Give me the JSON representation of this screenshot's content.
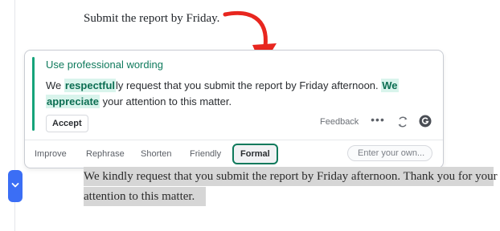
{
  "document": {
    "top_line": "Submit the report by Friday.",
    "selected_line_1": "We kindly request that you submit the report by Friday afternoon. Thank you for your",
    "selected_line_2": "attention to this matter."
  },
  "suggestion_card": {
    "title": "Use professional wording",
    "body": {
      "p1": "We ",
      "h1": "respectful",
      "p2": "ly request that you submit the report by Friday afternoon. ",
      "h2a": "We",
      "h2b": "appreciate",
      "p3": " your attention to this matter."
    },
    "accept_label": "Accept",
    "feedback_label": "Feedback",
    "more_icon": "•••",
    "icons": {
      "refresh": "refresh-icon",
      "brand": "grammarly-icon"
    },
    "accent_color": "#15a37a",
    "highlight_bg": "#d9f4ec",
    "highlight_text": "#0c6e52"
  },
  "tone_tabs": [
    {
      "label": "Improve",
      "active": false
    },
    {
      "label": "Rephrase",
      "active": false
    },
    {
      "label": "Shorten",
      "active": false
    },
    {
      "label": "Friendly",
      "active": false
    },
    {
      "label": "Formal",
      "active": true
    }
  ],
  "custom_prompt": {
    "placeholder": "Enter your own..."
  },
  "colors": {
    "arrow": "#e8261f",
    "side_toggle": "#3b6ef5",
    "selection": "#d6d6d6"
  }
}
